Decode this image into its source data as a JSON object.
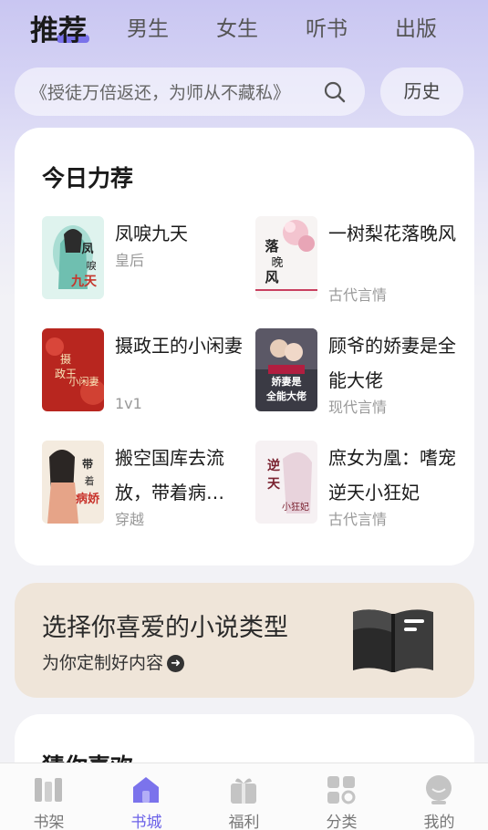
{
  "top_tabs": [
    {
      "label": "推荐",
      "active": true
    },
    {
      "label": "男生"
    },
    {
      "label": "女生"
    },
    {
      "label": "听书"
    },
    {
      "label": "出版"
    }
  ],
  "search": {
    "placeholder": "《授徒万倍返还，为师从不藏私》",
    "icon": "search-icon"
  },
  "history_label": "历史",
  "recommend": {
    "title": "今日力荐",
    "books": [
      {
        "title": "凤唳九天",
        "tag": "皇后",
        "cover_text": "凤唳九天"
      },
      {
        "title": "一树梨花落晚风",
        "tag": "古代言情",
        "cover_text": "落晚风"
      },
      {
        "title": "摄政王的小闲妻",
        "tag": "1v1",
        "cover_text": "摄政王的小闲妻"
      },
      {
        "title": "顾爷的娇妻是全能大佬",
        "tag": "现代言情",
        "cover_text": "娇妻是全能大佬"
      },
      {
        "title": "搬空国库去流放，带着病…",
        "tag": "穿越",
        "cover_text": "带着病娇"
      },
      {
        "title": "庶女为凰：嗜宠逆天小狂妃",
        "tag": "古代言情",
        "cover_text": "逆天小狂妃"
      }
    ]
  },
  "promo": {
    "title": "选择你喜爱的小说类型",
    "subtitle": "为你定制好内容",
    "arrow_icon": "arrow-right-icon"
  },
  "guess": {
    "title": "猜你喜欢"
  },
  "bottom_nav": [
    {
      "label": "书架",
      "icon": "bookshelf-icon"
    },
    {
      "label": "书城",
      "icon": "bookstore-icon",
      "active": true
    },
    {
      "label": "福利",
      "icon": "gift-icon"
    },
    {
      "label": "分类",
      "icon": "category-icon"
    },
    {
      "label": "我的",
      "icon": "profile-icon"
    }
  ],
  "colors": {
    "accent": "#6b62e8",
    "promo_bg": "#efe5d9",
    "header_gradient": "#c9c6f2"
  }
}
